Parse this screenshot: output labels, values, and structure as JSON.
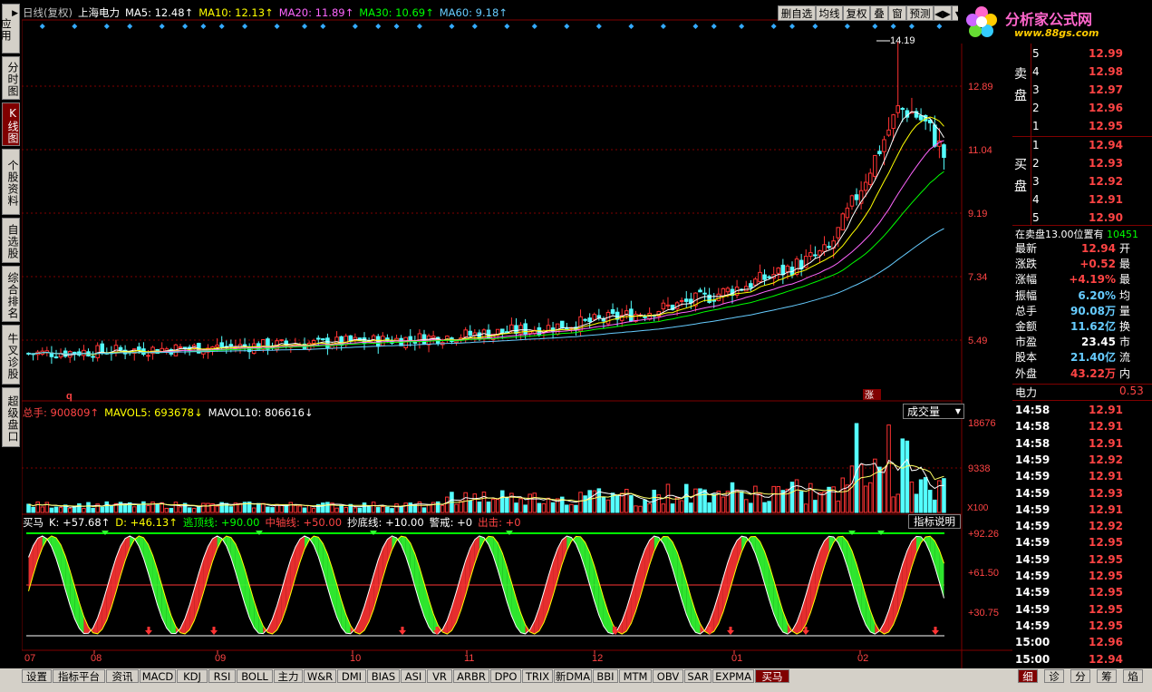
{
  "left_tabs": [
    "应用",
    "分时图",
    "K线图",
    "个股资料",
    "自选股",
    "综合排名",
    "牛叉诊股",
    "超级盘口"
  ],
  "left_tabs_active": 2,
  "left_arrow": "▶",
  "kline": {
    "title": "日线(复权)",
    "stock": "上海电力",
    "ma": [
      {
        "label": "MA5: 12.48↑",
        "color": "#ffffff"
      },
      {
        "label": "MA10: 12.13↑",
        "color": "#ffff00"
      },
      {
        "label": "MA20: 11.89↑",
        "color": "#ff66ff"
      },
      {
        "label": "MA30: 10.69↑",
        "color": "#00ff00"
      },
      {
        "label": "MA60: 9.18↑",
        "color": "#66ccff"
      }
    ],
    "price_ticks": [
      "12.89",
      "11.04",
      "9.19",
      "7.34",
      "5.49"
    ],
    "high_label": "14.19",
    "limit_label": "涨",
    "q_label": "q"
  },
  "toolbar": {
    "buttons": [
      "删自选",
      "均线",
      "复权",
      "叠",
      "窗",
      "预测",
      "◀▶"
    ],
    "close": "▼"
  },
  "volume": {
    "label_total": "总手: 900809↑",
    "label_mavol5": "MAVOL5: 693678↓",
    "label_mavol10": "MAVOL10: 806616↓",
    "ticks": [
      "18676",
      "9338"
    ],
    "unit": "X100",
    "dropdown": "成交量",
    "dropdown_arrow": "▼"
  },
  "indicator": {
    "name": "买马",
    "k": "K: +57.68↑",
    "d": "D: +46.13↑",
    "top_line": "逃顶线: +90.00",
    "mid_line": "中轴线: +50.00",
    "bottom_line": "抄底线: +10.00",
    "warn": "警戒: +0",
    "exit": "出击: +0",
    "ticks": [
      "+92.26",
      "+61.50",
      "+30.75"
    ],
    "help_button": "指标说明"
  },
  "x_axis": [
    "07",
    "08",
    "09",
    "10",
    "11",
    "12",
    "01",
    "02"
  ],
  "bottom_tabs": [
    "设置",
    "指标平台",
    "资讯",
    "MACD",
    "KDJ",
    "RSI",
    "BOLL",
    "主力",
    "W&R",
    "DMI",
    "BIAS",
    "ASI",
    "VR",
    "ARBR",
    "DPO",
    "TRIX",
    "新DMA",
    "BBI",
    "MTM",
    "OBV",
    "SAR",
    "EXPMA",
    "买马"
  ],
  "bottom_tabs_active": 22,
  "right_bottom_tabs": [
    "细",
    "诊",
    "分",
    "筹",
    "焰"
  ],
  "right_bottom_active": 0,
  "logo": {
    "name": "分析家公式网",
    "url": "www.88gs.com"
  },
  "orderbook": {
    "sell_label": "卖盘",
    "buy_label": "买盘",
    "sell": [
      {
        "level": "5",
        "price": "12.99"
      },
      {
        "level": "4",
        "price": "12.98"
      },
      {
        "level": "3",
        "price": "12.97"
      },
      {
        "level": "2",
        "price": "12.96"
      },
      {
        "level": "1",
        "price": "12.95"
      }
    ],
    "buy": [
      {
        "level": "1",
        "price": "12.94"
      },
      {
        "level": "2",
        "price": "12.93"
      },
      {
        "level": "3",
        "price": "12.92"
      },
      {
        "level": "4",
        "price": "12.91"
      },
      {
        "level": "5",
        "price": "12.90"
      }
    ],
    "notice": "在卖盘13.00位置有",
    "notice_value": "10451"
  },
  "quote": [
    {
      "k": "最新",
      "v": "12.94",
      "c": "#ff4444",
      "k2": "开"
    },
    {
      "k": "涨跌",
      "v": "+0.52",
      "c": "#ff4444",
      "k2": "最"
    },
    {
      "k": "涨幅",
      "v": "+4.19%",
      "c": "#ff4444",
      "k2": "最"
    },
    {
      "k": "振幅",
      "v": "6.20%",
      "c": "#66ccff",
      "k2": "均"
    },
    {
      "k": "总手",
      "v": "90.08万",
      "c": "#66ccff",
      "k2": "量"
    },
    {
      "k": "金额",
      "v": "11.62亿",
      "c": "#66ccff",
      "k2": "换"
    },
    {
      "k": "市盈",
      "v": "23.45",
      "c": "#ffffff",
      "k2": "市"
    },
    {
      "k": "股本",
      "v": "21.40亿",
      "c": "#66ccff",
      "k2": "流"
    },
    {
      "k": "外盘",
      "v": "43.22万",
      "c": "#ff4444",
      "k2": "内"
    }
  ],
  "sector": {
    "name": "电力",
    "value": "0.53"
  },
  "ticks_list": [
    {
      "t": "14:58",
      "p": "12.91"
    },
    {
      "t": "14:58",
      "p": "12.91"
    },
    {
      "t": "14:58",
      "p": "12.91"
    },
    {
      "t": "14:59",
      "p": "12.92"
    },
    {
      "t": "14:59",
      "p": "12.91"
    },
    {
      "t": "14:59",
      "p": "12.93"
    },
    {
      "t": "14:59",
      "p": "12.91"
    },
    {
      "t": "14:59",
      "p": "12.92"
    },
    {
      "t": "14:59",
      "p": "12.95"
    },
    {
      "t": "14:59",
      "p": "12.95"
    },
    {
      "t": "14:59",
      "p": "12.95"
    },
    {
      "t": "14:59",
      "p": "12.95"
    },
    {
      "t": "14:59",
      "p": "12.95"
    },
    {
      "t": "14:59",
      "p": "12.95"
    },
    {
      "t": "15:00",
      "p": "12.96"
    },
    {
      "t": "15:00",
      "p": "12.94"
    }
  ]
}
